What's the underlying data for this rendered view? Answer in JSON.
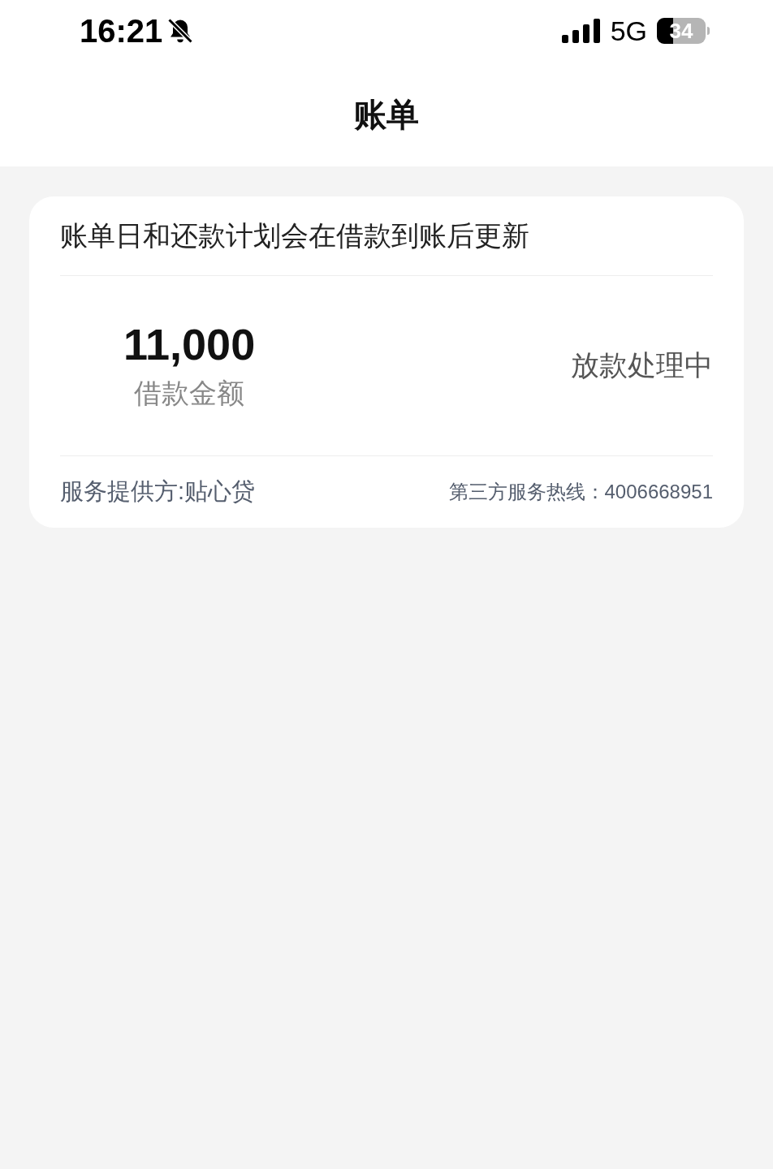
{
  "status_bar": {
    "time": "16:21",
    "network": "5G",
    "battery": "34"
  },
  "header": {
    "title": "账单"
  },
  "bill_card": {
    "notice": "账单日和还款计划会在借款到账后更新",
    "amount": "11,000",
    "amount_label": "借款金额",
    "status": "放款处理中",
    "provider": "服务提供方:贴心贷",
    "hotline": "第三方服务热线：4006668951"
  }
}
